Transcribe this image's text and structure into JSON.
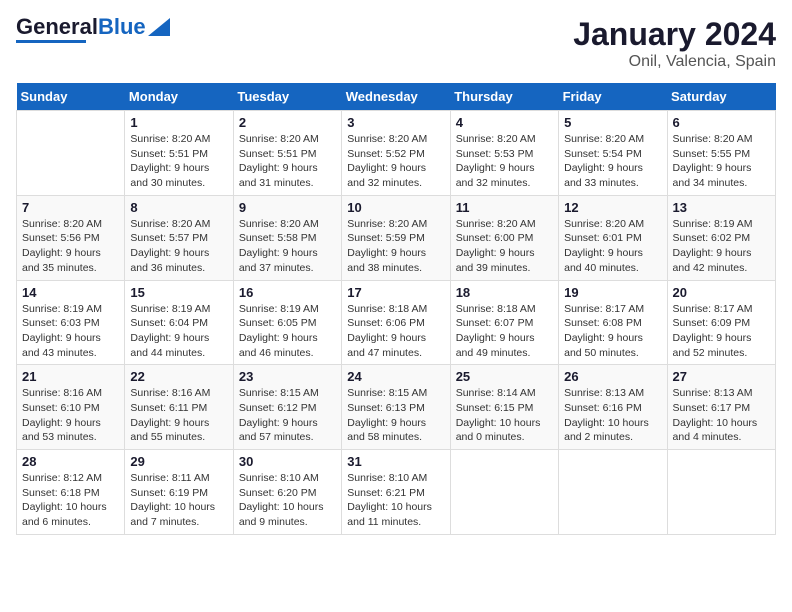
{
  "header": {
    "logo_general": "General",
    "logo_blue": "Blue",
    "title": "January 2024",
    "subtitle": "Onil, Valencia, Spain"
  },
  "calendar": {
    "weekdays": [
      "Sunday",
      "Monday",
      "Tuesday",
      "Wednesday",
      "Thursday",
      "Friday",
      "Saturday"
    ],
    "weeks": [
      [
        {
          "day": "",
          "info": ""
        },
        {
          "day": "1",
          "info": "Sunrise: 8:20 AM\nSunset: 5:51 PM\nDaylight: 9 hours\nand 30 minutes."
        },
        {
          "day": "2",
          "info": "Sunrise: 8:20 AM\nSunset: 5:51 PM\nDaylight: 9 hours\nand 31 minutes."
        },
        {
          "day": "3",
          "info": "Sunrise: 8:20 AM\nSunset: 5:52 PM\nDaylight: 9 hours\nand 32 minutes."
        },
        {
          "day": "4",
          "info": "Sunrise: 8:20 AM\nSunset: 5:53 PM\nDaylight: 9 hours\nand 32 minutes."
        },
        {
          "day": "5",
          "info": "Sunrise: 8:20 AM\nSunset: 5:54 PM\nDaylight: 9 hours\nand 33 minutes."
        },
        {
          "day": "6",
          "info": "Sunrise: 8:20 AM\nSunset: 5:55 PM\nDaylight: 9 hours\nand 34 minutes."
        }
      ],
      [
        {
          "day": "7",
          "info": "Sunrise: 8:20 AM\nSunset: 5:56 PM\nDaylight: 9 hours\nand 35 minutes."
        },
        {
          "day": "8",
          "info": "Sunrise: 8:20 AM\nSunset: 5:57 PM\nDaylight: 9 hours\nand 36 minutes."
        },
        {
          "day": "9",
          "info": "Sunrise: 8:20 AM\nSunset: 5:58 PM\nDaylight: 9 hours\nand 37 minutes."
        },
        {
          "day": "10",
          "info": "Sunrise: 8:20 AM\nSunset: 5:59 PM\nDaylight: 9 hours\nand 38 minutes."
        },
        {
          "day": "11",
          "info": "Sunrise: 8:20 AM\nSunset: 6:00 PM\nDaylight: 9 hours\nand 39 minutes."
        },
        {
          "day": "12",
          "info": "Sunrise: 8:20 AM\nSunset: 6:01 PM\nDaylight: 9 hours\nand 40 minutes."
        },
        {
          "day": "13",
          "info": "Sunrise: 8:19 AM\nSunset: 6:02 PM\nDaylight: 9 hours\nand 42 minutes."
        }
      ],
      [
        {
          "day": "14",
          "info": "Sunrise: 8:19 AM\nSunset: 6:03 PM\nDaylight: 9 hours\nand 43 minutes."
        },
        {
          "day": "15",
          "info": "Sunrise: 8:19 AM\nSunset: 6:04 PM\nDaylight: 9 hours\nand 44 minutes."
        },
        {
          "day": "16",
          "info": "Sunrise: 8:19 AM\nSunset: 6:05 PM\nDaylight: 9 hours\nand 46 minutes."
        },
        {
          "day": "17",
          "info": "Sunrise: 8:18 AM\nSunset: 6:06 PM\nDaylight: 9 hours\nand 47 minutes."
        },
        {
          "day": "18",
          "info": "Sunrise: 8:18 AM\nSunset: 6:07 PM\nDaylight: 9 hours\nand 49 minutes."
        },
        {
          "day": "19",
          "info": "Sunrise: 8:17 AM\nSunset: 6:08 PM\nDaylight: 9 hours\nand 50 minutes."
        },
        {
          "day": "20",
          "info": "Sunrise: 8:17 AM\nSunset: 6:09 PM\nDaylight: 9 hours\nand 52 minutes."
        }
      ],
      [
        {
          "day": "21",
          "info": "Sunrise: 8:16 AM\nSunset: 6:10 PM\nDaylight: 9 hours\nand 53 minutes."
        },
        {
          "day": "22",
          "info": "Sunrise: 8:16 AM\nSunset: 6:11 PM\nDaylight: 9 hours\nand 55 minutes."
        },
        {
          "day": "23",
          "info": "Sunrise: 8:15 AM\nSunset: 6:12 PM\nDaylight: 9 hours\nand 57 minutes."
        },
        {
          "day": "24",
          "info": "Sunrise: 8:15 AM\nSunset: 6:13 PM\nDaylight: 9 hours\nand 58 minutes."
        },
        {
          "day": "25",
          "info": "Sunrise: 8:14 AM\nSunset: 6:15 PM\nDaylight: 10 hours\nand 0 minutes."
        },
        {
          "day": "26",
          "info": "Sunrise: 8:13 AM\nSunset: 6:16 PM\nDaylight: 10 hours\nand 2 minutes."
        },
        {
          "day": "27",
          "info": "Sunrise: 8:13 AM\nSunset: 6:17 PM\nDaylight: 10 hours\nand 4 minutes."
        }
      ],
      [
        {
          "day": "28",
          "info": "Sunrise: 8:12 AM\nSunset: 6:18 PM\nDaylight: 10 hours\nand 6 minutes."
        },
        {
          "day": "29",
          "info": "Sunrise: 8:11 AM\nSunset: 6:19 PM\nDaylight: 10 hours\nand 7 minutes."
        },
        {
          "day": "30",
          "info": "Sunrise: 8:10 AM\nSunset: 6:20 PM\nDaylight: 10 hours\nand 9 minutes."
        },
        {
          "day": "31",
          "info": "Sunrise: 8:10 AM\nSunset: 6:21 PM\nDaylight: 10 hours\nand 11 minutes."
        },
        {
          "day": "",
          "info": ""
        },
        {
          "day": "",
          "info": ""
        },
        {
          "day": "",
          "info": ""
        }
      ]
    ]
  }
}
